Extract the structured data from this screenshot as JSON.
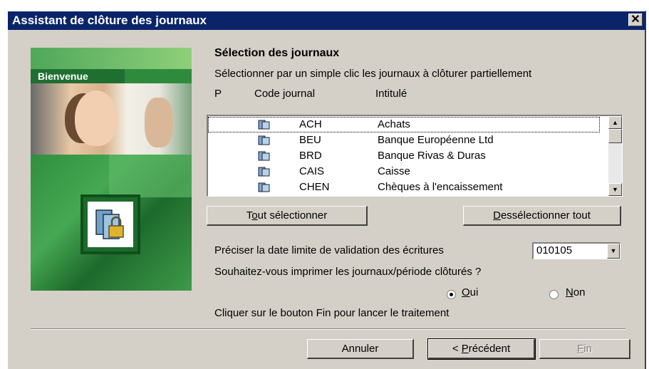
{
  "window": {
    "title": "Assistant de clôture des journaux",
    "close_glyph": "✕"
  },
  "sidebar": {
    "welcome_label": "Bienvenue"
  },
  "main": {
    "heading": "Sélection des journaux",
    "instruction": "Sélectionner par un simple clic les journaux à clôturer partiellement",
    "columns": {
      "p": "P",
      "code": "Code journal",
      "title": "Intitulé"
    },
    "journals": [
      {
        "code": "ACH",
        "title": "Achats",
        "icon": "journal-icon"
      },
      {
        "code": "BEU",
        "title": "Banque Européenne Ltd",
        "icon": "journal-icon"
      },
      {
        "code": "BRD",
        "title": "Banque Rivas & Duras",
        "icon": "journal-icon"
      },
      {
        "code": "CAIS",
        "title": "Caisse",
        "icon": "journal-icon"
      },
      {
        "code": "CHEN",
        "title": "Chèques à l'encaissement",
        "icon": "journal-icon"
      }
    ],
    "select_all": {
      "pre": "T",
      "u": "o",
      "post": "ut sélectionner"
    },
    "deselect_all": {
      "pre": "",
      "u": "D",
      "post": "essélectionner tout"
    },
    "date_label": "Préciser la date limite de validation des écritures",
    "date_value": "010105",
    "print_question": "Souhaitez-vous imprimer les journaux/période clôturés ?",
    "radio_yes": {
      "u": "O",
      "post": "ui",
      "checked": true
    },
    "radio_no": {
      "u": "N",
      "post": "on",
      "checked": false
    },
    "finish_hint": "Cliquer sur le bouton Fin pour lancer le traitement"
  },
  "footer": {
    "cancel": "Annuler",
    "previous": {
      "pre": "< ",
      "u": "P",
      "post": "récédent"
    },
    "finish": {
      "u": "F",
      "post": "in",
      "enabled": false
    }
  }
}
